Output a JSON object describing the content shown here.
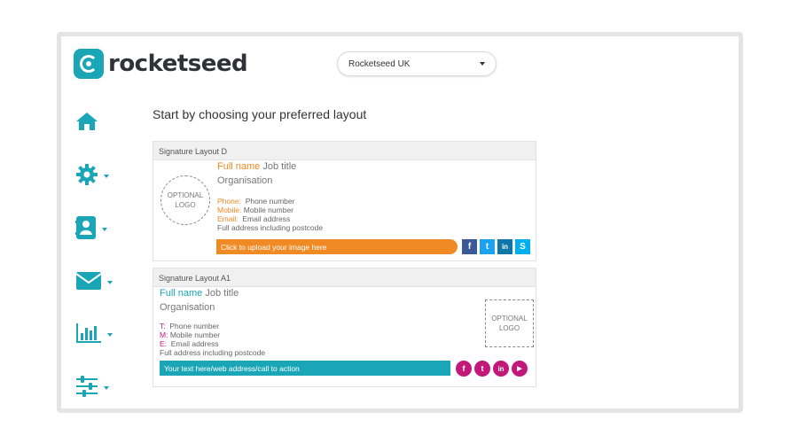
{
  "brand": {
    "name": "rocketseed"
  },
  "account_select": {
    "value": "Rocketseed UK"
  },
  "sidebar": {
    "items": [
      {
        "icon": "home-icon"
      },
      {
        "icon": "gear-icon"
      },
      {
        "icon": "contact-card-icon"
      },
      {
        "icon": "envelope-icon"
      },
      {
        "icon": "bar-chart-icon"
      },
      {
        "icon": "sliders-icon"
      }
    ]
  },
  "main": {
    "heading": "Start by choosing your preferred layout"
  },
  "layouts": [
    {
      "title": "Signature Layout D",
      "full_name": "Full name",
      "job_title": "Job title",
      "organisation": "Organisation",
      "logo_line1": "OPTIONAL",
      "logo_line2": "LOGO",
      "phone_label": "Phone:",
      "phone": "Phone number",
      "mobile_label": "Mobile:",
      "mobile": "Mobile number",
      "email_label": "Email:",
      "email": "Email address",
      "address": "Full address including postcode",
      "bar_text": "Click to upload your image here",
      "socials": [
        "f",
        "t",
        "in",
        "S"
      ],
      "accent": "#f08a24"
    },
    {
      "title": "Signature Layout A1",
      "full_name": "Full name",
      "job_title": "Job title",
      "organisation": "Organisation",
      "logo_line1": "OPTIONAL",
      "logo_line2": "LOGO",
      "phone_label": "T:",
      "phone": "Phone number",
      "mobile_label": "M:",
      "mobile": "Mobile number",
      "email_label": "E:",
      "email": "Email address",
      "address": "Full address including postcode",
      "bar_text": "Your text here/web address/call to action",
      "socials": [
        "f",
        "t",
        "in",
        "▶"
      ],
      "accent": "#1aa6b7"
    }
  ]
}
